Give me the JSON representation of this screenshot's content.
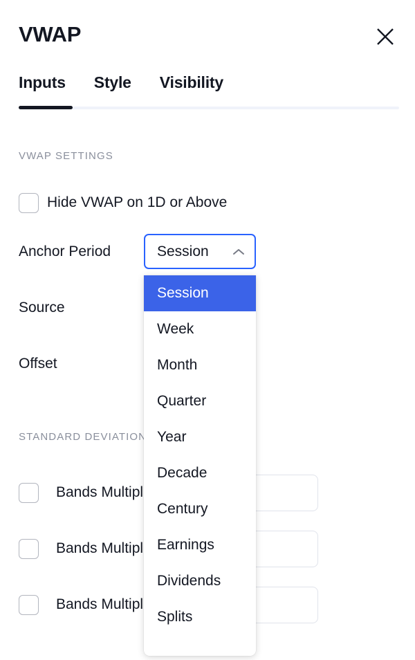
{
  "header": {
    "title": "VWAP",
    "close_icon": "close-icon"
  },
  "tabs": [
    {
      "label": "Inputs",
      "active": true
    },
    {
      "label": "Style",
      "active": false
    },
    {
      "label": "Visibility",
      "active": false
    }
  ],
  "sections": {
    "vwap_settings": {
      "label": "VWAP SETTINGS",
      "hide_vwap": {
        "label": "Hide VWAP on 1D or Above",
        "checked": false
      },
      "anchor_period": {
        "label": "Anchor Period",
        "value": "Session",
        "chevron_icon": "chevron-up-icon",
        "expanded": true,
        "options": [
          "Session",
          "Week",
          "Month",
          "Quarter",
          "Year",
          "Decade",
          "Century",
          "Earnings",
          "Dividends",
          "Splits"
        ]
      },
      "source": {
        "label": "Source"
      },
      "offset": {
        "label": "Offset"
      }
    },
    "stdev_settings": {
      "label": "STANDARD DEVIATIONS SETTINGS",
      "bands": [
        {
          "label": "Bands Multiplier #1",
          "checked": false,
          "value": ""
        },
        {
          "label": "Bands Multiplier #2",
          "checked": false,
          "value": ""
        },
        {
          "label": "Bands Multiplier #3",
          "checked": false,
          "value": ""
        }
      ]
    }
  },
  "colors": {
    "accent_blue": "#2962ff",
    "highlight_blue": "#3b63e8",
    "text": "#131722",
    "muted": "#8a8f9c",
    "border": "#e0e3eb"
  }
}
